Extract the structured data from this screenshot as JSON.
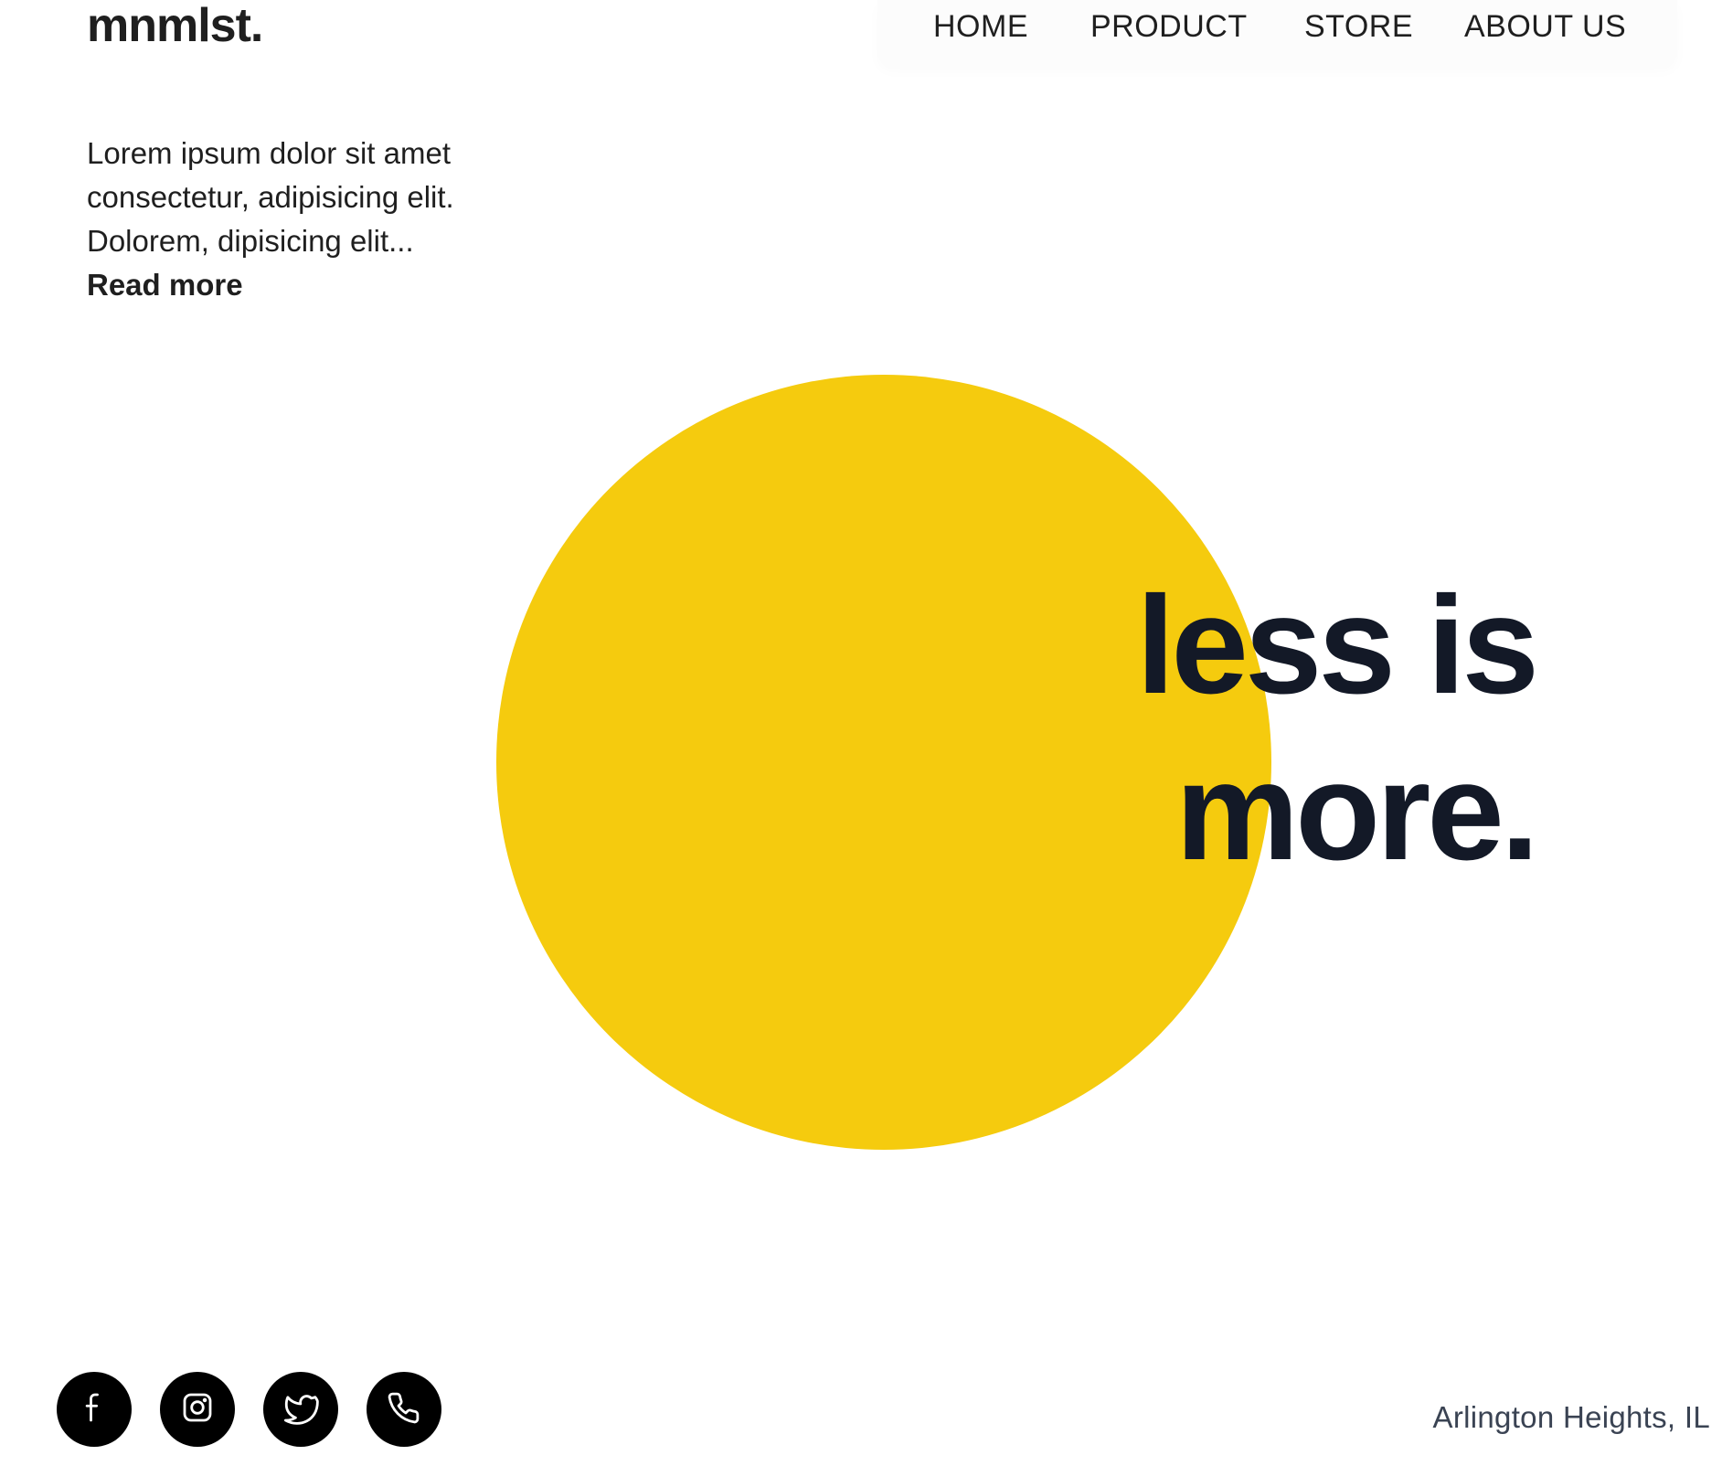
{
  "brand": {
    "logo": "mnmlst."
  },
  "nav": {
    "items": [
      {
        "label": "HOME"
      },
      {
        "label": "PRODUCT"
      },
      {
        "label": "STORE"
      },
      {
        "label": "ABOUT US"
      }
    ]
  },
  "intro": {
    "lines": [
      "Lorem ipsum dolor sit amet",
      "consectetur, adipisicing elit.",
      "Dolorem, dipisicing elit..."
    ],
    "read_more": "Read more"
  },
  "hero": {
    "lines": [
      "less is",
      "more."
    ]
  },
  "socials": [
    {
      "icon": "facebook-icon"
    },
    {
      "icon": "instagram-icon"
    },
    {
      "icon": "twitter-icon"
    },
    {
      "icon": "phone-icon"
    }
  ],
  "footer": {
    "location": "Arlington Heights, IL"
  },
  "colors": {
    "accent": "#f5cb0e",
    "text": "#1f1f1f",
    "hero_text": "#131927",
    "social_bg": "#000000",
    "location_text": "#3a4353"
  }
}
